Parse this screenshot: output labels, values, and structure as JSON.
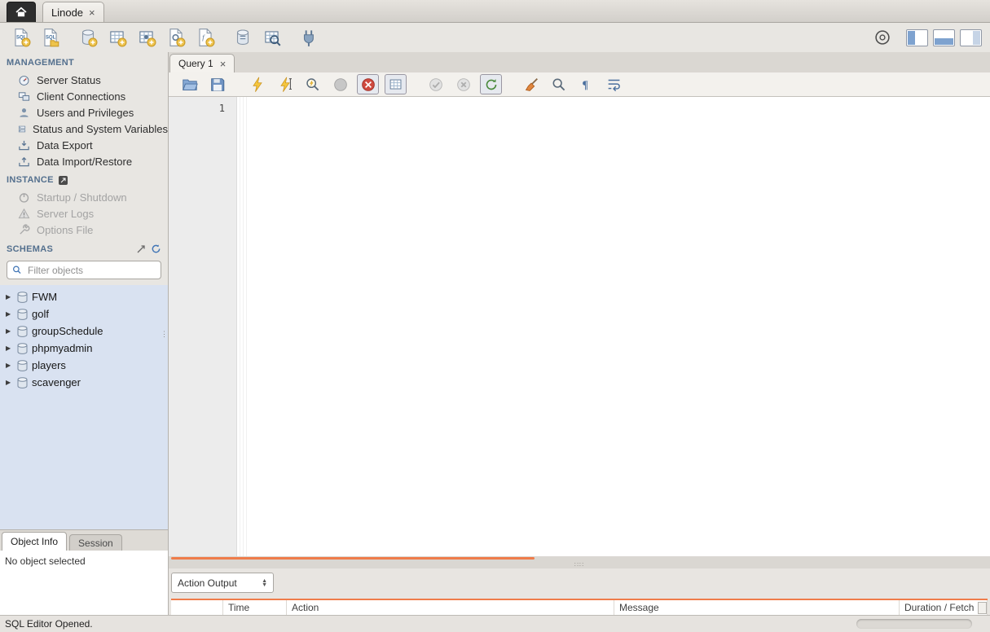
{
  "titlebar": {
    "tab_label": "Linode"
  },
  "icons": {
    "close": "×",
    "tree_expand": "▶",
    "caret_up": "▲",
    "caret_down": "▼",
    "splitter_dots": "∷∷",
    "vsplitter_dots": "⋮"
  },
  "sidebar": {
    "management": {
      "title": "MANAGEMENT",
      "items": [
        "Server Status",
        "Client Connections",
        "Users and Privileges",
        "Status and System Variables",
        "Data Export",
        "Data Import/Restore"
      ]
    },
    "instance": {
      "title": "INSTANCE",
      "items": [
        "Startup / Shutdown",
        "Server Logs",
        "Options File"
      ]
    },
    "schemas": {
      "title": "SCHEMAS",
      "filter_placeholder": "Filter objects",
      "items": [
        "FWM",
        "golf",
        "groupSchedule",
        "phpmyadmin",
        "players",
        "scavenger"
      ]
    },
    "info_tabs": {
      "object_info": "Object Info",
      "session": "Session"
    },
    "object_info_message": "No object selected"
  },
  "editor": {
    "tab_label": "Query 1",
    "line_number": "1"
  },
  "output": {
    "selector_value": "Action Output",
    "columns": [
      "Time",
      "Action",
      "Message",
      "Duration / Fetch"
    ]
  },
  "statusbar": {
    "message": "SQL Editor Opened."
  },
  "colors": {
    "accent_orange": "#ef7c4a",
    "schema_panel_blue": "#d9e2f1",
    "section_header_blue": "#54708e"
  }
}
